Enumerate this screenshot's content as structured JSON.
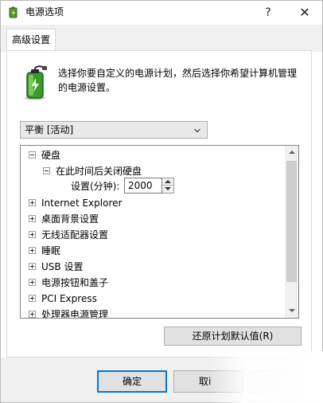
{
  "window": {
    "title": "电源选项",
    "help_label": "?",
    "close_label": "✕"
  },
  "tab": {
    "label": "高级设置"
  },
  "intro": {
    "line1": "选择你要自定义的电源计划，然后选择你希望计算机管理",
    "line2": "的电源设置。",
    "icon": "battery-plug-icon"
  },
  "plan": {
    "selected": "平衡 [活动]"
  },
  "tree": {
    "items": [
      {
        "label": "硬盘",
        "state": "expanded"
      },
      {
        "label": "在此时间后关闭硬盘",
        "state": "expanded"
      },
      {
        "label": "Internet Explorer",
        "state": "collapsed"
      },
      {
        "label": "桌面背景设置",
        "state": "collapsed"
      },
      {
        "label": "无线适配器设置",
        "state": "collapsed"
      },
      {
        "label": "睡眠",
        "state": "collapsed"
      },
      {
        "label": "USB 设置",
        "state": "collapsed"
      },
      {
        "label": "电源按钮和盖子",
        "state": "collapsed"
      },
      {
        "label": "PCI Express",
        "state": "collapsed"
      },
      {
        "label": "处理器电源管理",
        "state": "collapsed"
      }
    ],
    "setting_label": "设置(分钟):",
    "setting_value": "2000"
  },
  "buttons": {
    "restore": "还原计划默认值(R)",
    "ok": "确定",
    "cancel": "取i"
  },
  "colors": {
    "focus": "#0078d7",
    "battery": "#3a9a2a",
    "footer": "#f0f0f0"
  }
}
